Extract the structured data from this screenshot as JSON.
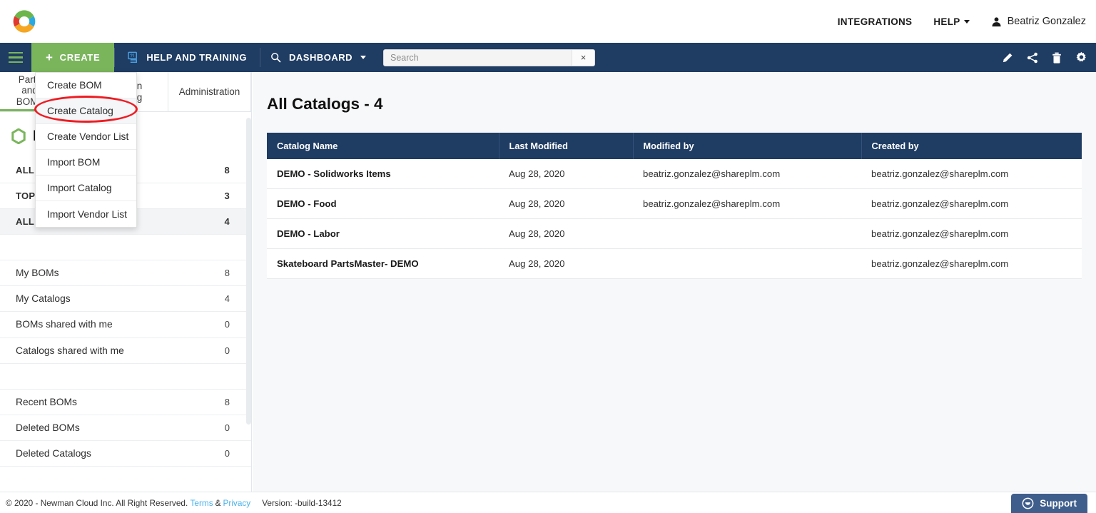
{
  "brand": {
    "logo_colors": [
      "#6cb64b",
      "#e0392f",
      "#29a9e1",
      "#f5a623"
    ],
    "navy": "#1f3c63",
    "green": "#7ab55c",
    "annotation_red": "#ee1c22"
  },
  "topbar": {
    "integrations_label": "INTEGRATIONS",
    "help_label": "HELP",
    "user_name": "Beatriz Gonzalez"
  },
  "navbar": {
    "create_label": "CREATE",
    "help_training_label": "HELP AND TRAINING",
    "dashboard_label": "DASHBOARD",
    "search": {
      "placeholder": "Search",
      "value": "",
      "clear_label": "×"
    },
    "tools": [
      "edit-icon",
      "share-icon",
      "trash-icon",
      "gear-icon"
    ]
  },
  "create_menu": {
    "items": [
      {
        "label": "Create BOM",
        "highlighted": false
      },
      {
        "label": "Create Catalog",
        "highlighted": true
      },
      {
        "label": "Create Vendor List",
        "highlighted": false
      },
      {
        "label": "Import BOM",
        "highlighted": false
      },
      {
        "label": "Import Catalog",
        "highlighted": false
      },
      {
        "label": "Import Vendor List",
        "highlighted": false
      }
    ]
  },
  "left_panel": {
    "tabs": [
      {
        "label": "Parts and BOMs",
        "active": true
      },
      {
        "label": "Collaboration\nand Sourcing",
        "active": false
      },
      {
        "label": "Administration",
        "active": false
      }
    ],
    "heading": "My BOMs",
    "groups": [
      {
        "items": [
          {
            "label": "ALL BOMS",
            "count": "8",
            "caps": true,
            "selected": false
          },
          {
            "label": "TOP LEVEL BOMS",
            "count": "3",
            "caps": true,
            "selected": false
          },
          {
            "label": "ALL CATALOGS",
            "count": "4",
            "caps": true,
            "selected": true
          }
        ]
      },
      {
        "items": [
          {
            "label": "My BOMs",
            "count": "8",
            "caps": false,
            "selected": false
          },
          {
            "label": "My Catalogs",
            "count": "4",
            "caps": false,
            "selected": false
          },
          {
            "label": "BOMs shared with me",
            "count": "0",
            "caps": false,
            "selected": false
          },
          {
            "label": "Catalogs shared with me",
            "count": "0",
            "caps": false,
            "selected": false
          }
        ]
      },
      {
        "items": [
          {
            "label": "Recent BOMs",
            "count": "8",
            "caps": false,
            "selected": false
          },
          {
            "label": "Deleted BOMs",
            "count": "0",
            "caps": false,
            "selected": false
          },
          {
            "label": "Deleted Catalogs",
            "count": "0",
            "caps": false,
            "selected": false
          }
        ]
      }
    ]
  },
  "main": {
    "title": "All Catalogs - 4",
    "table": {
      "headers": [
        "Catalog Name",
        "Last Modified",
        "Modified by",
        "Created by"
      ],
      "rows": [
        {
          "name": "DEMO - Solidworks Items",
          "last_modified": "Aug 28, 2020",
          "modified_by": "beatriz.gonzalez@shareplm.com",
          "created_by": "beatriz.gonzalez@shareplm.com"
        },
        {
          "name": "DEMO - Food",
          "last_modified": "Aug 28, 2020",
          "modified_by": "beatriz.gonzalez@shareplm.com",
          "created_by": "beatriz.gonzalez@shareplm.com"
        },
        {
          "name": "DEMO - Labor",
          "last_modified": "Aug 28, 2020",
          "modified_by": "",
          "created_by": "beatriz.gonzalez@shareplm.com"
        },
        {
          "name": "Skateboard PartsMaster- DEMO",
          "last_modified": "Aug 28, 2020",
          "modified_by": "",
          "created_by": "beatriz.gonzalez@shareplm.com"
        }
      ]
    }
  },
  "footer": {
    "copyright": "© 2020 - Newman Cloud Inc. All Right Reserved.",
    "terms_label": "Terms",
    "amp": "&",
    "privacy_label": "Privacy",
    "version": "Version: -build-13412",
    "support_label": "Support"
  }
}
